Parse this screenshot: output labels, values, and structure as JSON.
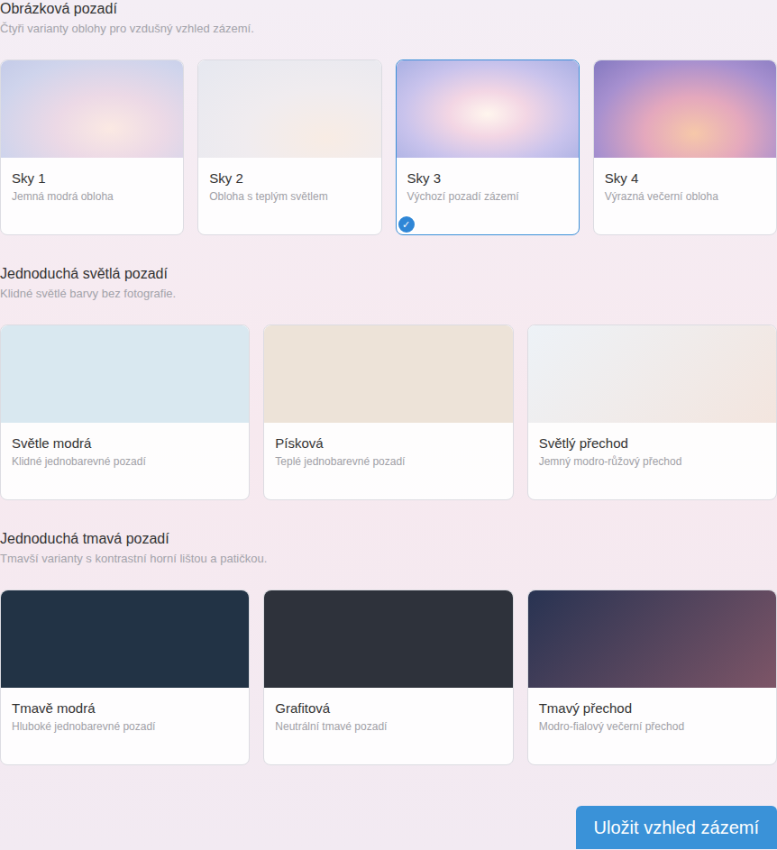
{
  "sections": [
    {
      "title": "Obrázková pozadí",
      "subtitle": "Čtyři varianty oblohy pro vzdušný vzhled zázemí.",
      "columns": 4,
      "options": [
        {
          "name": "Sky 1",
          "description": "Jemná modrá obloha",
          "kind": "photo",
          "selected": false
        },
        {
          "name": "Sky 2",
          "description": "Obloha s teplým světlem",
          "kind": "photo",
          "selected": false
        },
        {
          "name": "Sky 3",
          "description": "Výchozí pozadí zázemí",
          "kind": "photo",
          "selected": true
        },
        {
          "name": "Sky 4",
          "description": "Výrazná večerní obloha",
          "kind": "photo",
          "selected": false
        }
      ]
    },
    {
      "title": "Jednoduchá světlá pozadí",
      "subtitle": "Klidné světlé barvy bez fotografie.",
      "columns": 3,
      "options": [
        {
          "name": "Světle modrá",
          "description": "Klidné jednobarevné pozadí",
          "kind": "solid",
          "color": "#d9e8f0",
          "selected": false
        },
        {
          "name": "Písková",
          "description": "Teplé jednobarevné pozadí",
          "kind": "solid",
          "color": "#ede3d8",
          "selected": false
        },
        {
          "name": "Světlý přechod",
          "description": "Jemný modro-růžový přechod",
          "kind": "gradient",
          "color": "#edf2f7",
          "color_end": "#f3e5de",
          "selected": false
        }
      ]
    },
    {
      "title": "Jednoduchá tmavá pozadí",
      "subtitle": "Tmavší varianty s kontrastní horní lištou a patičkou.",
      "columns": 3,
      "options": [
        {
          "name": "Tmavě modrá",
          "description": "Hluboké jednobarevné pozadí",
          "kind": "solid",
          "color": "#223345",
          "selected": false
        },
        {
          "name": "Grafitová",
          "description": "Neutrální tmavé pozadí",
          "kind": "solid",
          "color": "#2e323b",
          "selected": false
        },
        {
          "name": "Tmavý přechod",
          "description": "Modro-fialový večerní přechod",
          "kind": "gradient",
          "color": "#283352",
          "color_end": "#7d5567",
          "selected": false
        }
      ]
    }
  ],
  "check_mark": "✓",
  "save_button": "Uložit vzhled zázemí"
}
